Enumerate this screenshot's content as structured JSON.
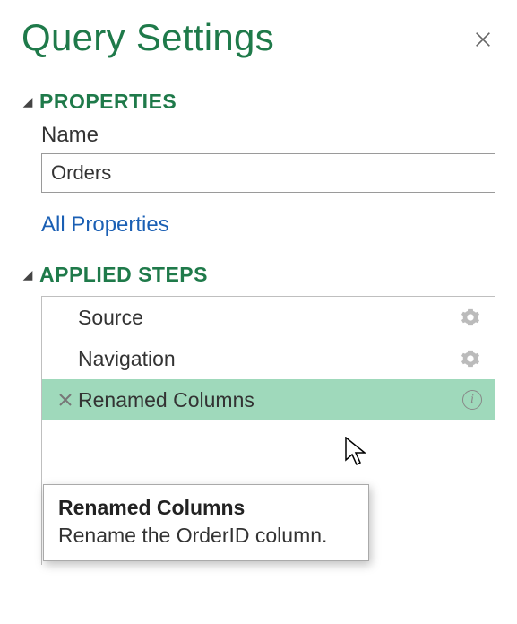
{
  "header": {
    "title": "Query Settings"
  },
  "sections": {
    "properties": {
      "title": "PROPERTIES",
      "name_label": "Name",
      "name_value": "Orders",
      "all_properties_link": "All Properties"
    },
    "applied_steps": {
      "title": "APPLIED STEPS",
      "steps": [
        {
          "label": "Source",
          "has_gear": true,
          "selected": false
        },
        {
          "label": "Navigation",
          "has_gear": true,
          "selected": false
        },
        {
          "label": "Renamed Columns",
          "has_gear": false,
          "selected": true
        }
      ]
    }
  },
  "tooltip": {
    "title": "Renamed Columns",
    "body": "Rename the OrderID column."
  },
  "icons": {
    "close": "close-icon",
    "collapse": "triangle-down-icon",
    "delete": "x-icon",
    "gear": "gear-icon",
    "info": "info-icon",
    "cursor": "cursor-icon"
  }
}
